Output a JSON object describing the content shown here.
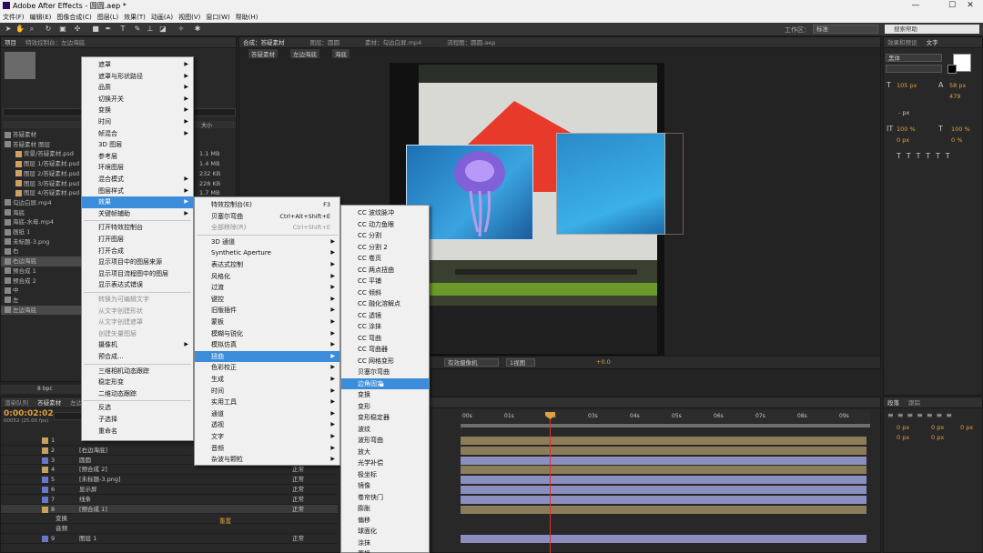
{
  "app": {
    "title": "Adobe After Effects - 圆圆.aep *"
  },
  "menubar": [
    "文件(F)",
    "编辑(E)",
    "图像合成(C)",
    "图层(L)",
    "效果(T)",
    "动画(A)",
    "视图(V)",
    "窗口(W)",
    "帮助(H)"
  ],
  "toolbar": {
    "workspace_label": "工作区：",
    "workspace_value": "标准",
    "search_placeholder": "搜索帮助"
  },
  "project_panel": {
    "tabs": [
      "项目",
      "特效控制台：左边海底"
    ],
    "col_size": "大小",
    "bpc": "8 bpc",
    "items": [
      {
        "name": "答疑素材",
        "size": ""
      },
      {
        "name": "答疑素材 图层",
        "size": ""
      },
      {
        "name": "背景/答疑素材.psd",
        "size": "1.1 MB"
      },
      {
        "name": "图层 1/答疑素材.psd",
        "size": "1.4 MB"
      },
      {
        "name": "图层 2/答疑素材.psd",
        "size": "232 KB"
      },
      {
        "name": "图层 3/答疑素材.psd",
        "size": "228 KB"
      },
      {
        "name": "图层 4/答疑素材.psd",
        "size": "1.7 MB"
      },
      {
        "name": "勾边白屏.mp4",
        "size": ""
      },
      {
        "name": "海底",
        "size": ""
      },
      {
        "name": "海底-水母.mp4",
        "size": ""
      },
      {
        "name": "画纸 1",
        "size": ""
      },
      {
        "name": "未标题-3.png",
        "size": ""
      },
      {
        "name": "右",
        "size": ""
      },
      {
        "name": "右边海底",
        "size": ""
      },
      {
        "name": "预合成 1",
        "size": ""
      },
      {
        "name": "预合成 2",
        "size": ""
      },
      {
        "name": "中",
        "size": ""
      },
      {
        "name": "左",
        "size": ""
      },
      {
        "name": "左边海底",
        "size": ""
      }
    ]
  },
  "viewer": {
    "tabs": [
      "合成：答疑素材",
      "图层：圆圆",
      "素材：勾边白屏.mp4",
      "流程图：圆圆.aep"
    ],
    "breadcrumbs": [
      "答疑素材",
      "左边海底",
      "海底"
    ],
    "bottom": {
      "camera": "有效摄像机",
      "view": "1视图",
      "offset": "+0.0"
    }
  },
  "right_panel": {
    "tabs": [
      "效果和预设",
      "文字"
    ],
    "font": "黑体",
    "size": "105 px",
    "leading": "58 px",
    "tracking": "479",
    "stroke": "- px",
    "vscale": "100 %",
    "hscale": "100 %",
    "baseline": "0 px",
    "tsume": "0 %",
    "para_tabs": [
      "段落",
      "跟踪"
    ],
    "para_values": [
      "0 px",
      "0 px",
      "0 px",
      "0 px",
      "0 px"
    ]
  },
  "timeline": {
    "tabs": [
      "渲染队列",
      "答疑素材",
      "左边海底"
    ],
    "timecode": "0:00:02:02",
    "frames": "00052 (25.00 fps)",
    "ruler": [
      "00s",
      "01s",
      "02s",
      "03s",
      "04s",
      "05s",
      "06s",
      "07s",
      "08s",
      "09s"
    ],
    "layers": [
      {
        "num": "1",
        "name": "",
        "mode": ""
      },
      {
        "num": "2",
        "name": "[右边海底]",
        "mode": ""
      },
      {
        "num": "3",
        "name": "圆圆",
        "mode": ""
      },
      {
        "num": "4",
        "name": "[预合成 2]",
        "mode": "正常"
      },
      {
        "num": "5",
        "name": "[未标题-3.png]",
        "mode": "正常"
      },
      {
        "num": "6",
        "name": "显示屏",
        "mode": "正常"
      },
      {
        "num": "7",
        "name": "线条",
        "mode": "正常"
      },
      {
        "num": "8",
        "name": "[预合成 1]",
        "mode": "正常"
      },
      {
        "num": "",
        "name": "变换",
        "mode": ""
      },
      {
        "num": "",
        "name": "音频",
        "mode": ""
      },
      {
        "num": "9",
        "name": "图层 1",
        "mode": "正常"
      }
    ],
    "reset": "重置"
  },
  "context_menu": {
    "items": [
      {
        "label": "遮罩",
        "sub": true
      },
      {
        "label": "遮罩与形状路径",
        "sub": true
      },
      {
        "label": "品质",
        "sub": true
      },
      {
        "label": "切换开关",
        "sub": true
      },
      {
        "label": "变换",
        "sub": true
      },
      {
        "label": "时间",
        "sub": true
      },
      {
        "label": "帧混合",
        "sub": true
      },
      {
        "label": "3D 图层",
        "sub": false
      },
      {
        "label": "参考层",
        "sub": false
      },
      {
        "label": "环境图层",
        "sub": false
      },
      {
        "label": "混合模式",
        "sub": true
      },
      {
        "label": "图层样式",
        "sub": true
      },
      {
        "label": "效果",
        "sub": true,
        "hl": true
      },
      {
        "label": "关键帧辅助",
        "sub": true
      },
      {
        "label": "打开特效控制台",
        "sub": false
      },
      {
        "label": "打开图层",
        "sub": false
      },
      {
        "label": "打开合成",
        "sub": false
      },
      {
        "label": "显示项目中的图层来源",
        "sub": false
      },
      {
        "label": "显示项目流程图中的图层",
        "sub": false
      },
      {
        "label": "显示表达式错误",
        "sub": false
      },
      {
        "label": "转换为可编辑文字",
        "sub": false,
        "dis": true
      },
      {
        "label": "从文字创建形状",
        "sub": false,
        "dis": true
      },
      {
        "label": "从文字创建遮罩",
        "sub": false,
        "dis": true
      },
      {
        "label": "创建矢量图层",
        "sub": false,
        "dis": true
      },
      {
        "label": "摄像机",
        "sub": true
      },
      {
        "label": "预合成...",
        "sub": false
      },
      {
        "label": "三维相机动态跟踪",
        "sub": false
      },
      {
        "label": "稳定形变",
        "sub": false
      },
      {
        "label": "二维动态跟踪",
        "sub": false
      },
      {
        "label": "反选",
        "sub": false
      },
      {
        "label": "子选择",
        "sub": false
      },
      {
        "label": "重命名",
        "sub": false
      }
    ]
  },
  "effect_menu": {
    "items": [
      {
        "label": "特效控制台(E)",
        "sc": "F3"
      },
      {
        "label": "贝塞尔弯曲",
        "sc": "Ctrl+Alt+Shift+E"
      },
      {
        "label": "全部移除(R)",
        "sc": "Ctrl+Shift+E",
        "dis": true
      },
      {
        "label": "3D 通道",
        "sub": true
      },
      {
        "label": "Synthetic Aperture",
        "sub": true
      },
      {
        "label": "表达式控制",
        "sub": true
      },
      {
        "label": "风格化",
        "sub": true
      },
      {
        "label": "过渡",
        "sub": true
      },
      {
        "label": "键控",
        "sub": true
      },
      {
        "label": "旧版插件",
        "sub": true
      },
      {
        "label": "蒙板",
        "sub": true
      },
      {
        "label": "模糊与锐化",
        "sub": true
      },
      {
        "label": "模拟仿真",
        "sub": true
      },
      {
        "label": "扭曲",
        "sub": true,
        "hl": true
      },
      {
        "label": "色彩校正",
        "sub": true
      },
      {
        "label": "生成",
        "sub": true
      },
      {
        "label": "时间",
        "sub": true
      },
      {
        "label": "实用工具",
        "sub": true
      },
      {
        "label": "通道",
        "sub": true
      },
      {
        "label": "透视",
        "sub": true
      },
      {
        "label": "文字",
        "sub": true
      },
      {
        "label": "音频",
        "sub": true
      },
      {
        "label": "杂波与颗粒",
        "sub": true
      }
    ]
  },
  "distort_menu": {
    "items": [
      "CC 波纹脉冲",
      "CC 动力鱼眼",
      "CC 分割",
      "CC 分割 2",
      "CC 卷页",
      "CC 两点扭曲",
      "CC 平铺",
      "CC 倾斜",
      "CC 融化溶解点",
      "CC 透镜",
      "CC 涂抹",
      "CC 弯曲",
      "CC 弯曲器",
      "CC 网格变形",
      "贝塞尔弯曲",
      "边角固定",
      "变换",
      "变形",
      "变形稳定器",
      "波纹",
      "波形弯曲",
      "放大",
      "光学补偿",
      "极坐标",
      "镜像",
      "卷帘快门",
      "膨胀",
      "偏移",
      "球面化",
      "涂抹",
      "置换"
    ],
    "highlight_index": 15
  }
}
